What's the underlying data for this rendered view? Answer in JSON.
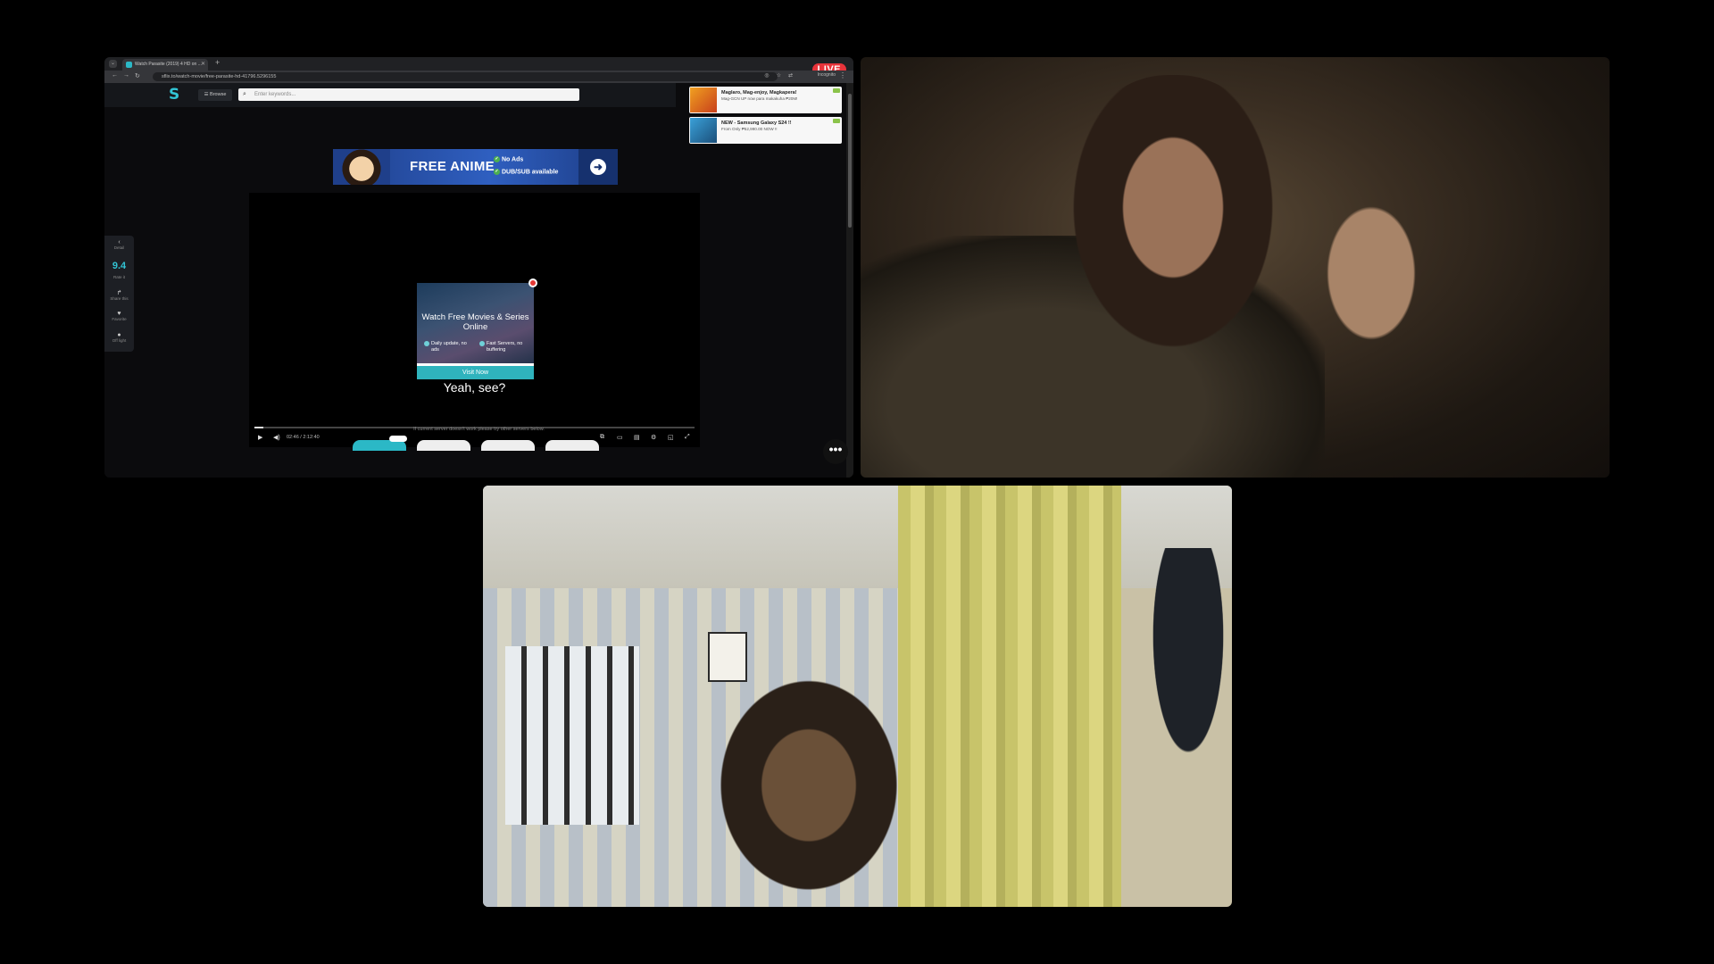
{
  "live_badge": "LIVE",
  "browser": {
    "tab_title": "Watch Parasite (2019) 4 HD on ...",
    "url": "sflix.to/watch-movie/free-parasite-hd-41796.5296155",
    "incognito_label": "Incognito"
  },
  "site": {
    "browse_label": "☰ Browse",
    "search_placeholder": "Enter keywords...",
    "ads": [
      {
        "title": "Maglaro, Mag-enjoy, Magkapera!",
        "subtitle": "Mag-GCN UP now para makakuha ₱20M!"
      },
      {
        "title": "NEW - Samsung Galaxy S24 !!",
        "subtitle": "From Only ₱52,990.00 NOW !!"
      }
    ],
    "banner": {
      "title": "FREE ANIME",
      "feature_1": "No Ads",
      "feature_2": "DUB/SUB available"
    },
    "popup": {
      "title": "Watch Free Movies & Series Online",
      "feature_1": "Daily update, no ads",
      "feature_2": "Fast Servers, no buffering",
      "button": "Visit Now"
    },
    "subtitle_text": "Yeah, see?",
    "player": {
      "time": "02:46 / 2:12:40",
      "progress": 0.02
    },
    "server_note": "If current server doesn't work please try other servers below.",
    "rail": {
      "back_label": "Detail",
      "rating": "9.4",
      "rating_label": "Rate it",
      "share_label": "Share this",
      "favorite_label": "Favorite",
      "light_label": "Off light"
    }
  }
}
